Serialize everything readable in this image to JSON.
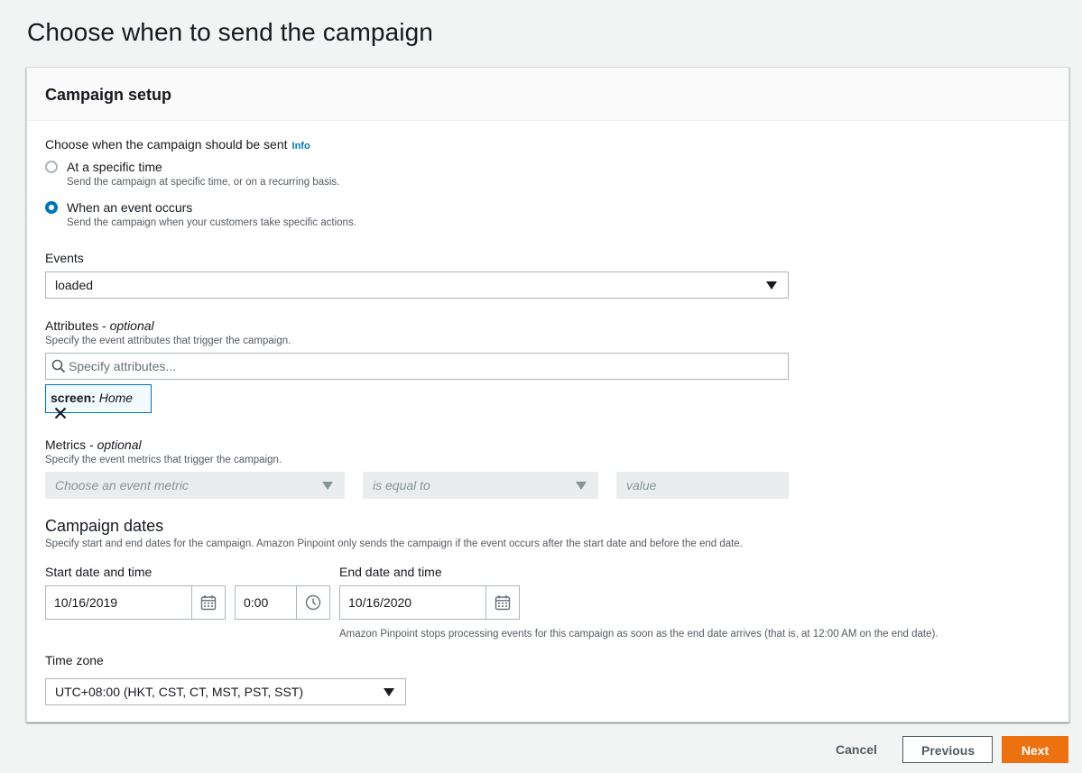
{
  "page": {
    "title": "Choose when to send the campaign"
  },
  "panel": {
    "title": "Campaign setup"
  },
  "send_choice": {
    "label": "Choose when the campaign should be sent",
    "info_link": "Info",
    "options": [
      {
        "label": "At a specific time",
        "description": "Send the campaign at specific time, or on a recurring basis.",
        "checked": false
      },
      {
        "label": "When an event occurs",
        "description": "Send the campaign when your customers take specific actions.",
        "checked": true
      }
    ]
  },
  "events": {
    "label": "Events",
    "selected": "loaded"
  },
  "attributes": {
    "label": "Attributes",
    "optional": "optional",
    "description": "Specify the event attributes that trigger the campaign.",
    "search_placeholder": "Specify attributes...",
    "token_key": "screen:",
    "token_value": "Home"
  },
  "metrics": {
    "label": "Metrics",
    "optional": "optional",
    "description": "Specify the event metrics that trigger the campaign.",
    "metric_placeholder": "Choose an event metric",
    "operator_placeholder": "is equal to",
    "value_placeholder": "value"
  },
  "campaign_dates": {
    "heading": "Campaign dates",
    "description": "Specify start and end dates for the campaign. Amazon Pinpoint only sends the campaign if the event occurs after the start date and before the end date.",
    "start_label": "Start date and time",
    "start_date": "10/16/2019",
    "start_time": "0:00",
    "end_label": "End date and time",
    "end_date": "10/16/2020",
    "end_note": "Amazon Pinpoint stops processing events for this campaign as soon as the end date arrives (that is, at 12:00 AM on the end date)."
  },
  "timezone": {
    "label": "Time zone",
    "selected": "UTC+08:00 (HKT, CST, CT, MST, PST, SST)"
  },
  "footer": {
    "cancel": "Cancel",
    "previous": "Previous",
    "next": "Next"
  },
  "colors": {
    "accent": "#0073bb",
    "primary_button": "#ec7211",
    "background": "#f2f3f3"
  },
  "icons": [
    "search-icon",
    "close-icon",
    "calendar-icon",
    "clock-icon",
    "caret-down-icon"
  ]
}
